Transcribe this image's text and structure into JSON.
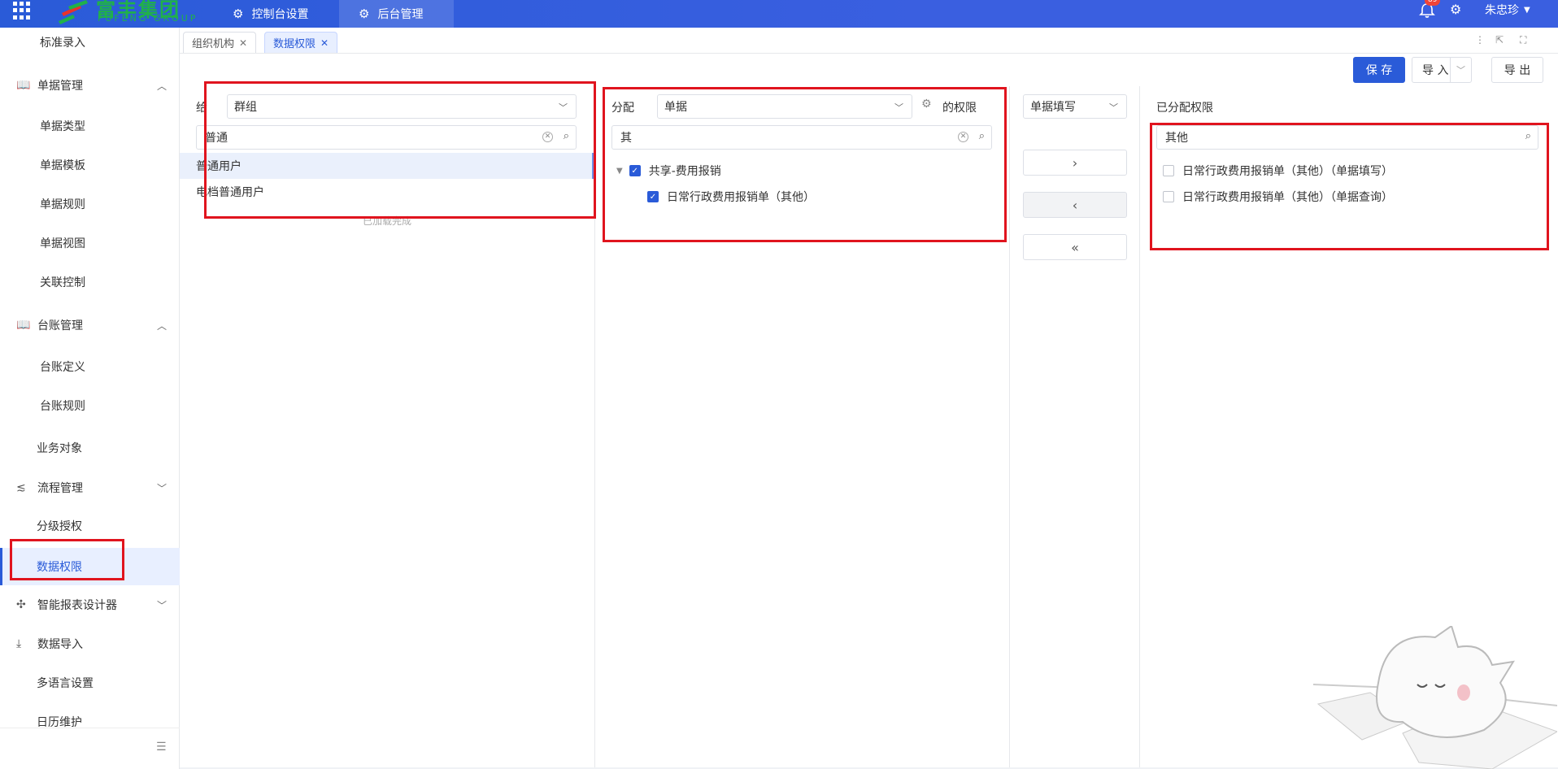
{
  "app": {
    "logo_text": "富丰集团",
    "logo_sub": "FUFENG GROUP",
    "nav_tabs": [
      {
        "label": "控制台设置",
        "icon": "settings-nodes-icon"
      },
      {
        "label": "后台管理",
        "icon": "settings-nodes-icon"
      }
    ],
    "notification_count": "89",
    "user_name": "朱忠珍"
  },
  "sidebar": {
    "items": [
      {
        "label": "标准录入",
        "type": "sub"
      },
      {
        "label": "单据管理",
        "type": "group",
        "icon": "book-icon",
        "expanded": true
      },
      {
        "label": "单据类型",
        "type": "sub"
      },
      {
        "label": "单据模板",
        "type": "sub"
      },
      {
        "label": "单据规则",
        "type": "sub"
      },
      {
        "label": "单据视图",
        "type": "sub"
      },
      {
        "label": "关联控制",
        "type": "sub"
      },
      {
        "label": "台账管理",
        "type": "group",
        "icon": "book-icon",
        "expanded": true
      },
      {
        "label": "台账定义",
        "type": "sub"
      },
      {
        "label": "台账规则",
        "type": "sub"
      },
      {
        "label": "业务对象",
        "type": "plain"
      },
      {
        "label": "流程管理",
        "type": "group",
        "icon": "flow-icon",
        "expanded": false
      },
      {
        "label": "分级授权",
        "type": "plain"
      },
      {
        "label": "数据权限",
        "type": "plain",
        "active": true
      },
      {
        "label": "智能报表设计器",
        "type": "group",
        "icon": "puzzle-icon",
        "expanded": false
      },
      {
        "label": "数据导入",
        "type": "group",
        "icon": "import-icon"
      },
      {
        "label": "多语言设置",
        "type": "plain"
      },
      {
        "label": "日历维护",
        "type": "plain"
      }
    ]
  },
  "page_tabs": [
    {
      "label": "组织机构",
      "active": false
    },
    {
      "label": "数据权限",
      "active": true
    }
  ],
  "toolbar": {
    "save_label": "保 存",
    "import_label": "导 入",
    "export_label": "导 出"
  },
  "group_panel": {
    "label": "给",
    "select_value": "群组",
    "search_value": "普通",
    "items": [
      "普通用户",
      "电档普通用户"
    ],
    "loaded_text": "已加载完成"
  },
  "assign_panel": {
    "label": "分配",
    "select_value": "单据",
    "suffix_label": "的权限",
    "search_value": "其",
    "tree": {
      "parent": "共享-费用报销",
      "child": "日常行政费用报销单（其他）"
    }
  },
  "middle_panel": {
    "select_value": "单据填写"
  },
  "assigned_panel": {
    "title": "已分配权限",
    "search_value": "其他",
    "items": [
      "日常行政费用报销单（其他）（单据填写）",
      "日常行政费用报销单（其他）（单据查询）"
    ]
  }
}
